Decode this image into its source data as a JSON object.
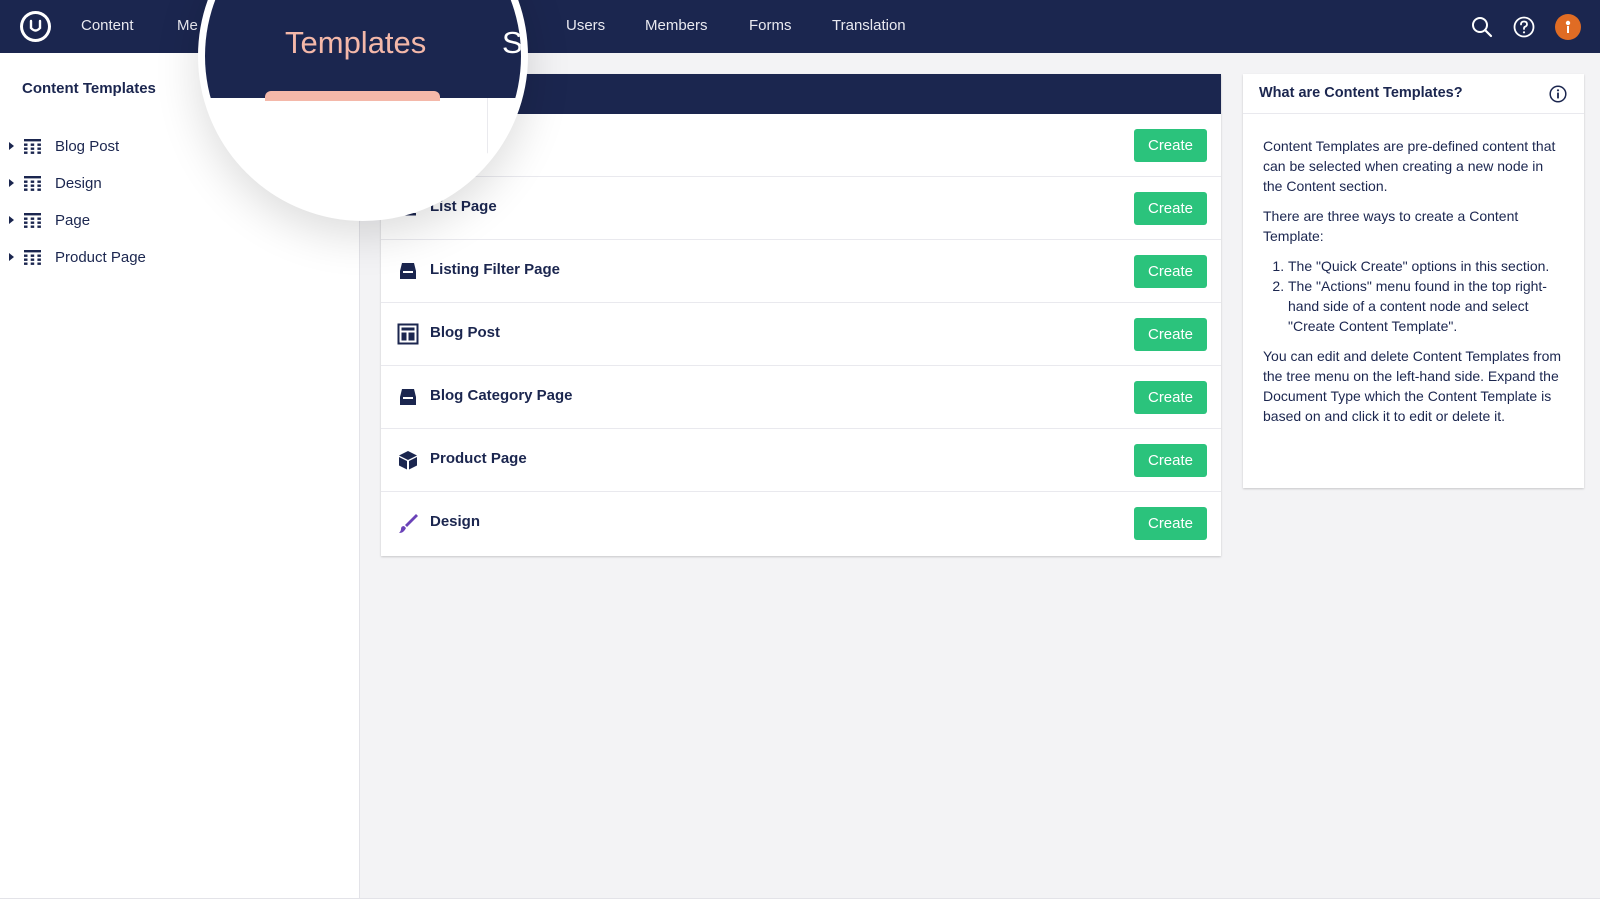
{
  "nav": {
    "items": [
      {
        "label": "Content"
      },
      {
        "label": "Me"
      },
      {
        "label": "Users"
      },
      {
        "label": "Members"
      },
      {
        "label": "Forms"
      },
      {
        "label": "Translation"
      }
    ],
    "search_icon": "search-icon",
    "help_icon": "help-circle-icon",
    "avatar_icon": "user-avatar"
  },
  "magnifier": {
    "title": "Templates",
    "partial_text": "S"
  },
  "tree": {
    "title": "Content Templates",
    "items": [
      {
        "label": "Blog Post",
        "icon": "grid-icon"
      },
      {
        "label": "Design",
        "icon": "grid-icon"
      },
      {
        "label": "Page",
        "icon": "grid-icon"
      },
      {
        "label": "Product Page",
        "icon": "grid-icon"
      }
    ]
  },
  "templates": {
    "create_label": "Create",
    "rows": [
      {
        "name": "",
        "icon": "document-icon"
      },
      {
        "name": "List Page",
        "icon": "list-icon"
      },
      {
        "name": "Listing Filter Page",
        "icon": "inbox-icon"
      },
      {
        "name": "Blog Post",
        "icon": "layout-icon"
      },
      {
        "name": "Blog Category Page",
        "icon": "inbox-icon"
      },
      {
        "name": "Product Page",
        "icon": "box-icon"
      },
      {
        "name": "Design",
        "icon": "brush-icon"
      }
    ]
  },
  "help": {
    "title": "What are Content Templates?",
    "intro": "Content Templates are pre-defined content that can be selected when creating a new node in the Content section.",
    "ways_intro": "There are three ways to create a Content Template:",
    "ways": [
      "The \"Quick Create\" options in this section.",
      "The \"Actions\" menu found in the top right-hand side of a content node and select \"Create Content Template\"."
    ],
    "outro": "You can edit and delete Content Templates from the tree menu on the left-hand side. Expand the Document Type which the Content Template is based on and click it to edit or delete it."
  },
  "colors": {
    "navy": "#1b264f",
    "create_green": "#2bc37c",
    "accent_pink": "#f4b8a9",
    "avatar_orange": "#e06c24"
  }
}
